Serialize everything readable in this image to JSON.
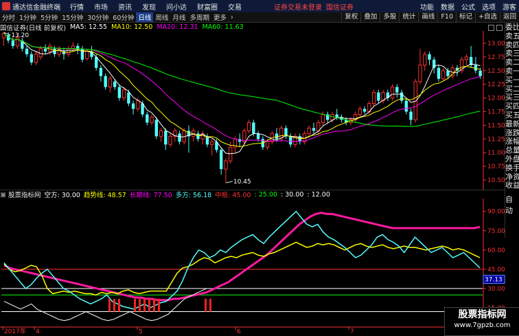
{
  "titlebar": {
    "app_name": "通达信金融终端",
    "menus": [
      "行情",
      "市场",
      "资讯",
      "发现",
      "问小达",
      "财富圈",
      "交易"
    ],
    "notice": "证券交易未登录",
    "broker": "国信证券",
    "right": [
      "功能",
      "数据",
      "公式",
      "选项",
      "游客"
    ]
  },
  "toolbar": {
    "periods": [
      "分时",
      "1分钟",
      "5分钟",
      "15分钟",
      "30分钟",
      "60分钟",
      "日线",
      "周线",
      "月线",
      "多周期",
      "更多"
    ],
    "active_period": "日线",
    "tools": [
      "复权",
      "叠加",
      "多股",
      "统计",
      "画线",
      "F10",
      "标记",
      "+自选",
      "返回"
    ]
  },
  "info": {
    "stock": "国信证券(日线 前复权)",
    "ma5": "MA5: 12.55",
    "ma10": "MA10: 12.50",
    "ma20": "MA20: 12.31",
    "ma60": "MA60: 11.63"
  },
  "sidebar": [
    "委比",
    "卖五",
    "卖四",
    "卖三",
    "卖二",
    "卖一",
    "买一",
    "买二",
    "买三",
    "买四",
    "买五",
    "最新",
    "涨跌",
    "涨幅",
    "总量",
    "外盘",
    "换手",
    "净资",
    "收益"
  ],
  "sidebar_lower": "自动",
  "indicator": {
    "name": "股票指标网",
    "kong": "空方: 30.00",
    "trend": "趋势线: 48.57",
    "longline": "长期线: 77.50",
    "duo": "多方: 56.18",
    "zhongshu": "中枢: 45.00",
    "level25": ": 25.00",
    "level30": ": 30.00",
    "level12": ": 12.00",
    "cursor_value": "37.13"
  },
  "xaxis": [
    "2017年",
    "4",
    "5",
    "6",
    "7"
  ],
  "watermark": {
    "title": "股票指标网",
    "url": "www.7gpzb.com"
  },
  "colors": {
    "up": "#ff3232",
    "down": "#54ffff",
    "ma5": "#ffffff",
    "ma10": "#ffff00",
    "ma20": "#ff00ff",
    "ma60": "#00ff00",
    "axis": "#ff3232"
  },
  "chart_data": [
    {
      "type": "candlestick",
      "title": "国信证券(日线 前复权)",
      "ylim": [
        10.35,
        13.2
      ],
      "yticks": [
        10.5,
        10.75,
        11.0,
        11.25,
        11.5,
        11.75,
        12.0,
        12.25,
        12.5,
        12.75,
        13.0
      ],
      "annotations": [
        {
          "label": "13.20",
          "value": 13.2
        },
        {
          "label": "10.45",
          "value": 10.45
        }
      ],
      "candles": [
        [
          13.1,
          13.18,
          12.95,
          13.2
        ],
        [
          13.15,
          13.05,
          13.0,
          13.2
        ],
        [
          13.05,
          12.95,
          12.9,
          13.1
        ],
        [
          12.95,
          13.1,
          12.9,
          13.15
        ],
        [
          13.05,
          12.9,
          12.85,
          13.1
        ],
        [
          12.9,
          12.8,
          12.75,
          12.95
        ],
        [
          12.8,
          12.65,
          12.6,
          12.85
        ],
        [
          12.65,
          12.8,
          12.6,
          12.85
        ],
        [
          12.75,
          12.9,
          12.7,
          12.95
        ],
        [
          12.9,
          12.85,
          12.8,
          12.98
        ],
        [
          12.85,
          12.95,
          12.78,
          13.0
        ],
        [
          12.9,
          12.8,
          12.75,
          12.95
        ],
        [
          12.8,
          12.9,
          12.75,
          12.95
        ],
        [
          12.85,
          12.8,
          12.7,
          12.92
        ],
        [
          12.8,
          12.9,
          12.75,
          12.95
        ],
        [
          12.9,
          12.95,
          12.85,
          13.02
        ],
        [
          12.95,
          12.9,
          12.8,
          13.0
        ],
        [
          12.9,
          12.7,
          12.65,
          12.95
        ],
        [
          12.72,
          12.85,
          12.68,
          12.9
        ],
        [
          12.85,
          12.75,
          12.7,
          12.95
        ],
        [
          12.75,
          12.55,
          12.5,
          12.8
        ],
        [
          12.55,
          12.4,
          12.3,
          12.6
        ],
        [
          12.4,
          12.2,
          12.15,
          12.45
        ],
        [
          12.2,
          12.35,
          12.1,
          12.4
        ],
        [
          12.3,
          12.2,
          12.15,
          12.35
        ],
        [
          12.2,
          12.0,
          11.95,
          12.25
        ],
        [
          12.0,
          12.15,
          11.95,
          12.2
        ],
        [
          12.1,
          11.9,
          11.85,
          12.15
        ],
        [
          11.9,
          11.8,
          11.7,
          11.95
        ],
        [
          11.8,
          11.95,
          11.75,
          12.0
        ],
        [
          11.9,
          11.7,
          11.65,
          11.95
        ],
        [
          11.7,
          11.55,
          11.5,
          11.75
        ],
        [
          11.55,
          11.65,
          11.5,
          11.7
        ],
        [
          11.6,
          11.3,
          11.25,
          11.65
        ],
        [
          11.3,
          11.4,
          11.2,
          11.45
        ],
        [
          11.4,
          11.15,
          11.05,
          11.45
        ],
        [
          11.15,
          11.3,
          11.1,
          11.35
        ],
        [
          11.3,
          11.4,
          11.2,
          11.45
        ],
        [
          11.35,
          11.2,
          11.15,
          11.4
        ],
        [
          11.2,
          11.4,
          11.15,
          11.45
        ],
        [
          11.4,
          11.3,
          11.0,
          11.5
        ],
        [
          11.3,
          11.4,
          11.2,
          11.45
        ],
        [
          11.35,
          11.25,
          11.2,
          11.4
        ],
        [
          11.25,
          11.35,
          11.15,
          11.4
        ],
        [
          11.3,
          11.15,
          11.1,
          11.35
        ],
        [
          11.15,
          11.2,
          10.95,
          11.25
        ],
        [
          11.2,
          11.05,
          11.0,
          11.25
        ],
        [
          11.05,
          10.7,
          10.6,
          11.1
        ],
        [
          10.7,
          10.85,
          10.45,
          10.9
        ],
        [
          10.85,
          11.1,
          10.8,
          11.2
        ],
        [
          11.1,
          11.25,
          11.0,
          11.3
        ],
        [
          11.25,
          11.2,
          11.1,
          11.35
        ],
        [
          11.2,
          11.4,
          11.15,
          11.45
        ],
        [
          11.4,
          11.55,
          11.35,
          11.6
        ],
        [
          11.55,
          11.35,
          11.3,
          11.6
        ],
        [
          11.35,
          11.25,
          11.2,
          11.4
        ],
        [
          11.25,
          11.1,
          11.05,
          11.3
        ],
        [
          11.1,
          11.2,
          11.05,
          11.25
        ],
        [
          11.2,
          11.35,
          11.15,
          11.4
        ],
        [
          11.35,
          11.25,
          11.2,
          11.45
        ],
        [
          11.25,
          11.45,
          11.2,
          11.5
        ],
        [
          11.45,
          11.3,
          11.25,
          11.5
        ],
        [
          11.3,
          11.15,
          11.1,
          11.35
        ],
        [
          11.15,
          11.3,
          11.1,
          11.35
        ],
        [
          11.3,
          11.2,
          11.15,
          11.35
        ],
        [
          11.2,
          11.35,
          11.15,
          11.4
        ],
        [
          11.35,
          11.45,
          11.3,
          11.5
        ],
        [
          11.45,
          11.4,
          11.35,
          11.55
        ],
        [
          11.4,
          11.55,
          11.35,
          11.6
        ],
        [
          11.55,
          11.7,
          11.5,
          11.75
        ],
        [
          11.7,
          11.6,
          11.55,
          11.75
        ],
        [
          11.6,
          11.7,
          11.55,
          11.75
        ],
        [
          11.7,
          11.65,
          11.6,
          11.8
        ],
        [
          11.65,
          11.6,
          11.55,
          11.7
        ],
        [
          11.6,
          11.55,
          11.5,
          11.65
        ],
        [
          11.55,
          11.6,
          11.5,
          11.65
        ],
        [
          11.6,
          11.7,
          11.55,
          11.75
        ],
        [
          11.7,
          11.8,
          11.65,
          11.85
        ],
        [
          11.8,
          11.75,
          11.7,
          11.85
        ],
        [
          11.75,
          11.9,
          11.7,
          11.95
        ],
        [
          11.9,
          12.1,
          11.85,
          12.15
        ],
        [
          12.1,
          11.95,
          11.9,
          12.15
        ],
        [
          11.95,
          12.1,
          11.9,
          12.15
        ],
        [
          12.1,
          12.0,
          11.95,
          12.15
        ],
        [
          12.0,
          12.2,
          11.95,
          12.25
        ],
        [
          12.2,
          12.1,
          12.0,
          12.25
        ],
        [
          12.1,
          11.95,
          11.9,
          12.15
        ],
        [
          11.95,
          11.75,
          11.7,
          12.0
        ],
        [
          11.75,
          11.6,
          11.5,
          11.8
        ],
        [
          11.6,
          12.3,
          11.55,
          12.35
        ],
        [
          12.3,
          12.6,
          12.25,
          12.9
        ],
        [
          12.6,
          12.8,
          12.5,
          12.85
        ],
        [
          12.8,
          12.7,
          12.6,
          12.85
        ],
        [
          12.7,
          12.55,
          12.45,
          12.75
        ],
        [
          12.55,
          12.35,
          12.3,
          12.6
        ],
        [
          12.35,
          12.5,
          12.3,
          12.55
        ],
        [
          12.5,
          12.4,
          12.35,
          12.55
        ],
        [
          12.4,
          12.55,
          12.35,
          12.6
        ],
        [
          12.55,
          12.5,
          12.4,
          12.6
        ],
        [
          12.5,
          12.7,
          12.45,
          12.75
        ],
        [
          12.7,
          12.75,
          12.6,
          12.8
        ],
        [
          12.75,
          12.6,
          12.55,
          12.95
        ],
        [
          12.6,
          12.5,
          12.45,
          12.75
        ],
        [
          12.5,
          12.4,
          12.35,
          12.55
        ]
      ],
      "series": [
        {
          "name": "MA5",
          "role": "ma5"
        },
        {
          "name": "MA10",
          "role": "ma10"
        },
        {
          "name": "MA20",
          "role": "ma20"
        },
        {
          "name": "MA60",
          "role": "ma60"
        }
      ]
    },
    {
      "type": "line",
      "title": "股票指标网",
      "ylim": [
        0,
        100
      ],
      "yticks": [
        15,
        30,
        45,
        60,
        75,
        90
      ],
      "yticklabels": [
        "15.00",
        "30.00",
        "45.00",
        "60.00",
        "75.00",
        "90.00"
      ],
      "hlines": [
        {
          "name": "中枢",
          "value": 45
        },
        {
          "name": "30",
          "value": 30
        },
        {
          "name": "25",
          "value": 25
        },
        {
          "name": "12",
          "value": 12
        }
      ],
      "series": [
        {
          "name": "趋势线",
          "values": [
            48,
            46,
            45,
            44,
            43,
            42,
            41,
            40,
            39,
            38,
            37,
            36,
            35,
            34,
            33,
            32,
            31,
            30,
            29,
            28,
            27,
            26,
            25,
            24,
            23,
            23,
            22,
            22,
            21,
            21,
            21,
            22,
            22,
            23,
            24,
            25,
            26,
            27,
            29,
            31,
            33,
            35,
            38,
            41,
            44,
            47,
            50,
            53,
            56,
            60,
            64,
            68,
            72,
            76,
            80,
            83,
            86,
            88,
            89,
            88,
            88,
            87,
            86,
            85,
            84,
            83,
            82,
            81,
            80,
            79,
            78,
            77,
            77,
            77,
            77,
            77,
            77,
            77,
            77,
            77,
            77,
            77,
            77,
            77,
            77,
            77,
            77,
            78
          ]
        },
        {
          "name": "长期线",
          "values": [
            49,
            45,
            43,
            44,
            46,
            48,
            47,
            40,
            30,
            26,
            27,
            28,
            27,
            28,
            27,
            26,
            26,
            25,
            27,
            26,
            27,
            26,
            28,
            29,
            27,
            26,
            27,
            28,
            28,
            28,
            28,
            35,
            42,
            46,
            47,
            49,
            52,
            54,
            53,
            50,
            52,
            54,
            55,
            54,
            56,
            57,
            58,
            56,
            55,
            57,
            58,
            60,
            62,
            64,
            66,
            64,
            62,
            63,
            65,
            64,
            65,
            64,
            62,
            60,
            62,
            64,
            65,
            63,
            62,
            63,
            64,
            62,
            61,
            62,
            63,
            62,
            62,
            61,
            60,
            61,
            62,
            63,
            62,
            60,
            61,
            60,
            58,
            56,
            54
          ]
        },
        {
          "name": "多方",
          "values": [
            50,
            45,
            40,
            35,
            30,
            33,
            38,
            42,
            45,
            40,
            35,
            30,
            28,
            25,
            22,
            20,
            18,
            20,
            22,
            25,
            20,
            18,
            16,
            15,
            14,
            16,
            18,
            15,
            17,
            19,
            20,
            24,
            28,
            36,
            46,
            54,
            60,
            58,
            54,
            56,
            60,
            58,
            62,
            65,
            68,
            70,
            72,
            68,
            65,
            70,
            74,
            78,
            82,
            86,
            90,
            85,
            80,
            78,
            80,
            74,
            70,
            68,
            65,
            62,
            58,
            54,
            56,
            60,
            64,
            70,
            72,
            68,
            66,
            63,
            58,
            64,
            70,
            66,
            62,
            58,
            60,
            62,
            58,
            54,
            56,
            58,
            54,
            50,
            46
          ]
        },
        {
          "name": "空方",
          "values": [
            20,
            18,
            16,
            14,
            16,
            18,
            14,
            12,
            10,
            8,
            6,
            5,
            6,
            8,
            10,
            12,
            10,
            8,
            6,
            5,
            6,
            8,
            10,
            12,
            10,
            8,
            6,
            5,
            6,
            8,
            10,
            14,
            18,
            22,
            24,
            26,
            28,
            30
          ]
        }
      ],
      "signals": [
        "III",
        "IIIIII",
        "II"
      ]
    }
  ]
}
